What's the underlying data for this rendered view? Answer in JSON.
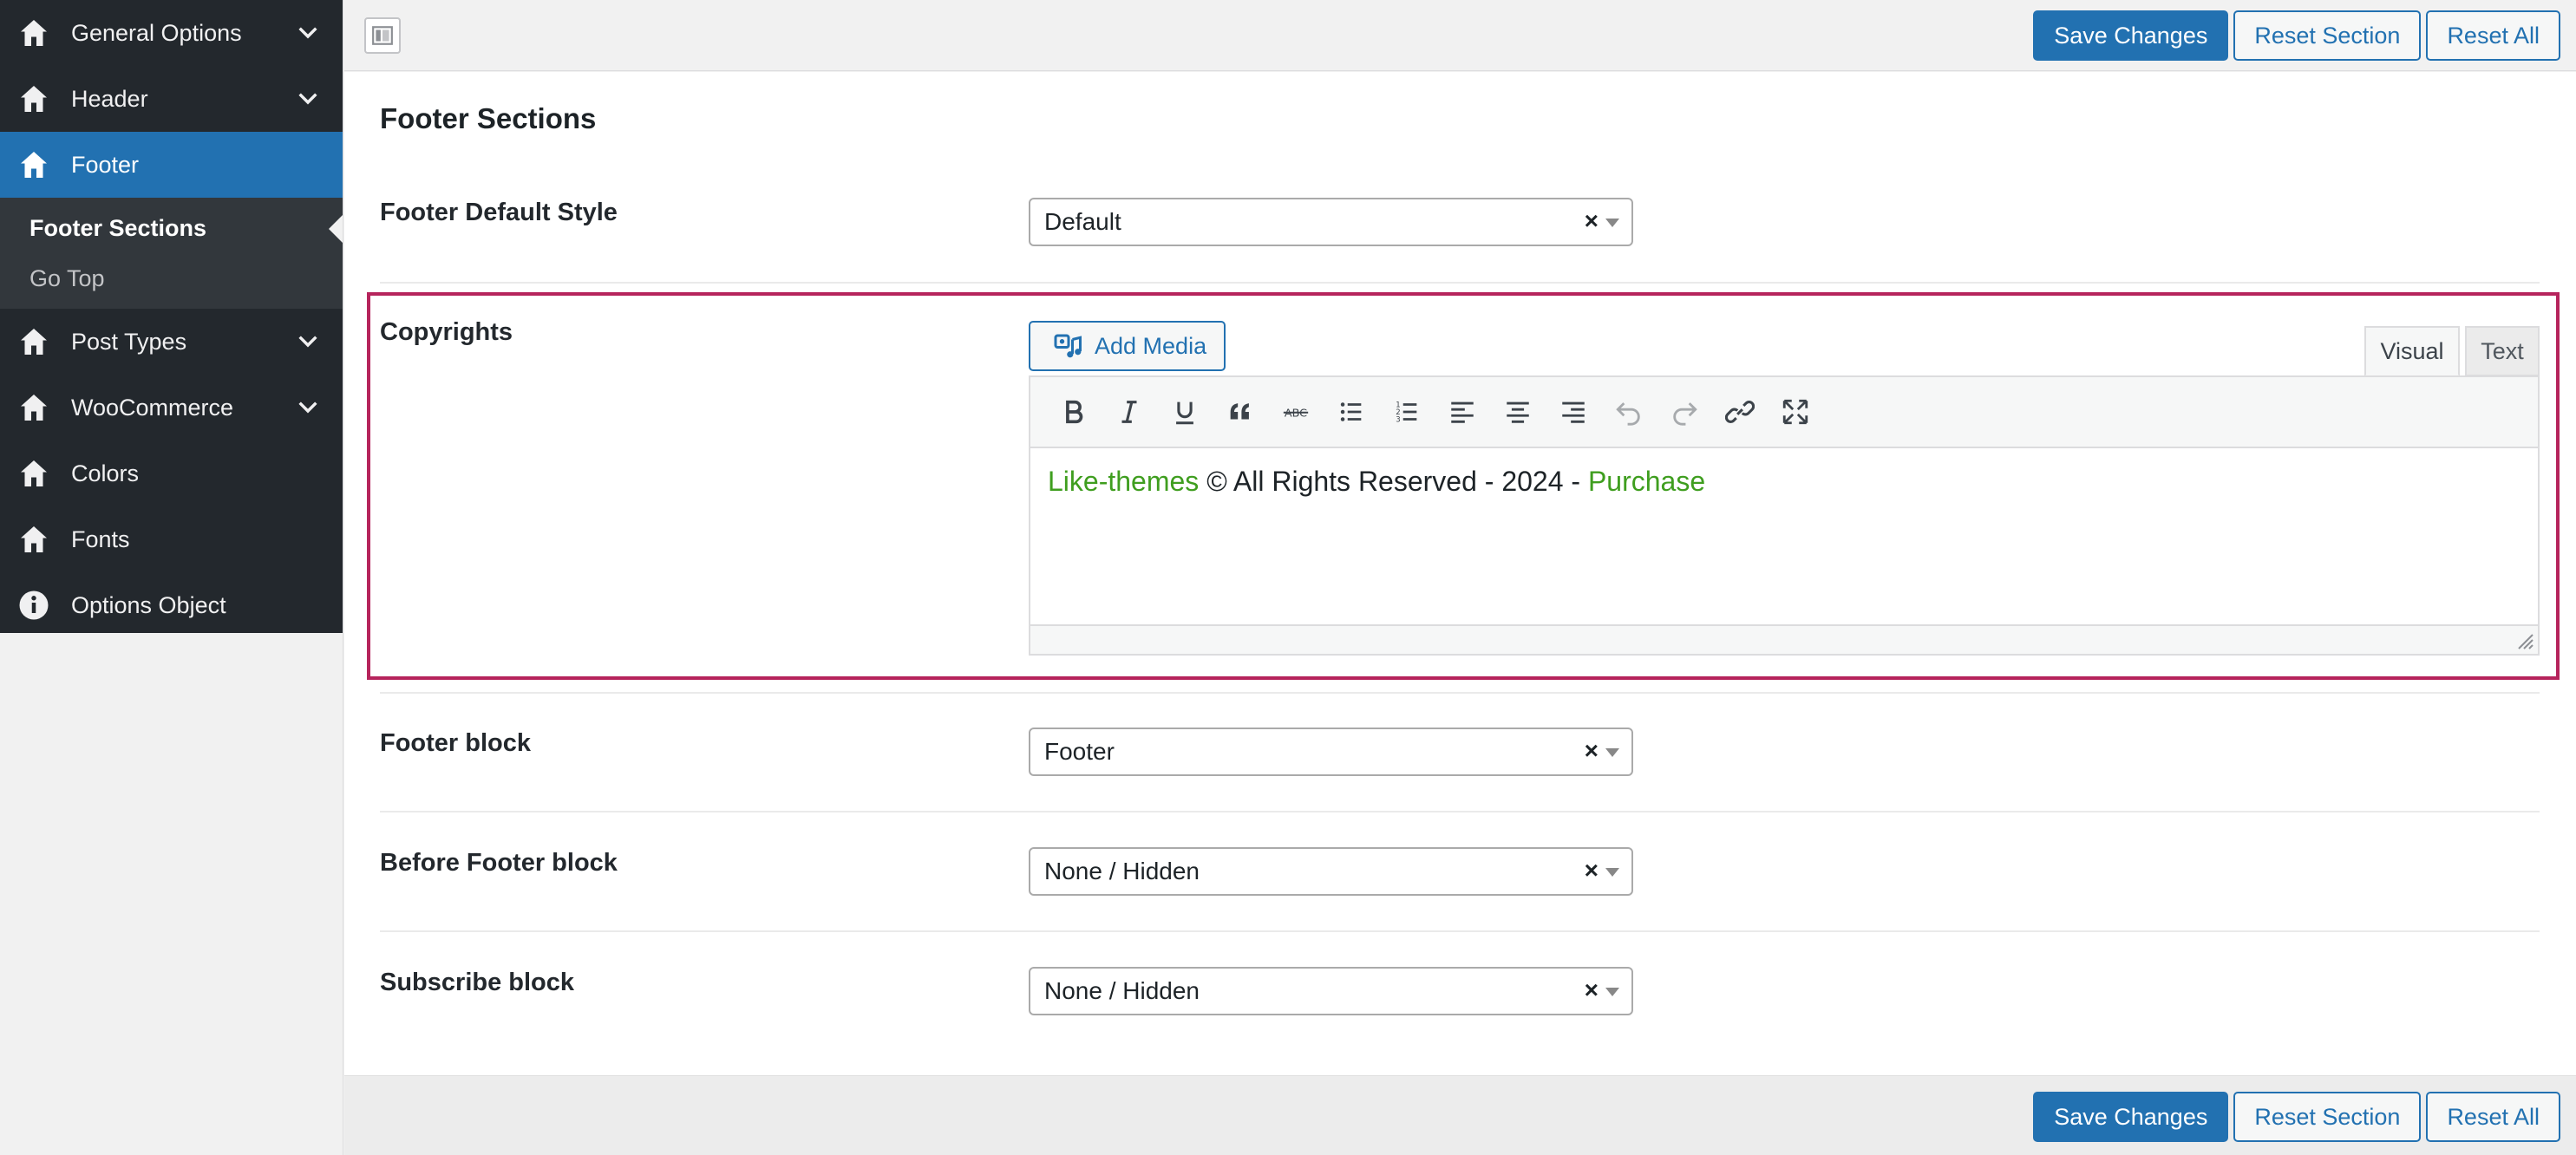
{
  "sidebar": {
    "items": [
      {
        "label": "General Options",
        "icon": "home-icon",
        "has_submenu": true
      },
      {
        "label": "Header",
        "icon": "home-icon",
        "has_submenu": true
      },
      {
        "label": "Footer",
        "icon": "home-icon",
        "active": true
      },
      {
        "label": "Post Types",
        "icon": "home-icon",
        "has_submenu": true
      },
      {
        "label": "WooCommerce",
        "icon": "home-icon",
        "has_submenu": true
      },
      {
        "label": "Colors",
        "icon": "home-icon"
      },
      {
        "label": "Fonts",
        "icon": "home-icon"
      },
      {
        "label": "Options Object",
        "icon": "info-icon"
      }
    ],
    "subitems": [
      {
        "label": "Footer Sections",
        "current": true
      },
      {
        "label": "Go Top"
      }
    ]
  },
  "toolbar": {
    "save_label": "Save Changes",
    "reset_section_label": "Reset Section",
    "reset_all_label": "Reset All"
  },
  "main": {
    "title": "Footer Sections",
    "fields": {
      "footer_default_style": {
        "label": "Footer Default Style",
        "value": "Default"
      },
      "copyrights": {
        "label": "Copyrights",
        "add_media_label": "Add Media",
        "tab_visual": "Visual",
        "tab_text": "Text",
        "content": {
          "link1": "Like-themes",
          "middle": " © All Rights Reserved - 2024 - ",
          "link2": "Purchase"
        }
      },
      "footer_block": {
        "label": "Footer block",
        "value": "Footer"
      },
      "before_footer_block": {
        "label": "Before Footer block",
        "value": "None / Hidden"
      },
      "subscribe_block": {
        "label": "Subscribe block",
        "value": "None / Hidden"
      }
    },
    "clear_glyph": "×"
  },
  "colors": {
    "sidebar_bg": "#23282d",
    "active_blue": "#2271b1",
    "highlight_border": "#b6245c",
    "link_green": "#3f9e1f"
  }
}
